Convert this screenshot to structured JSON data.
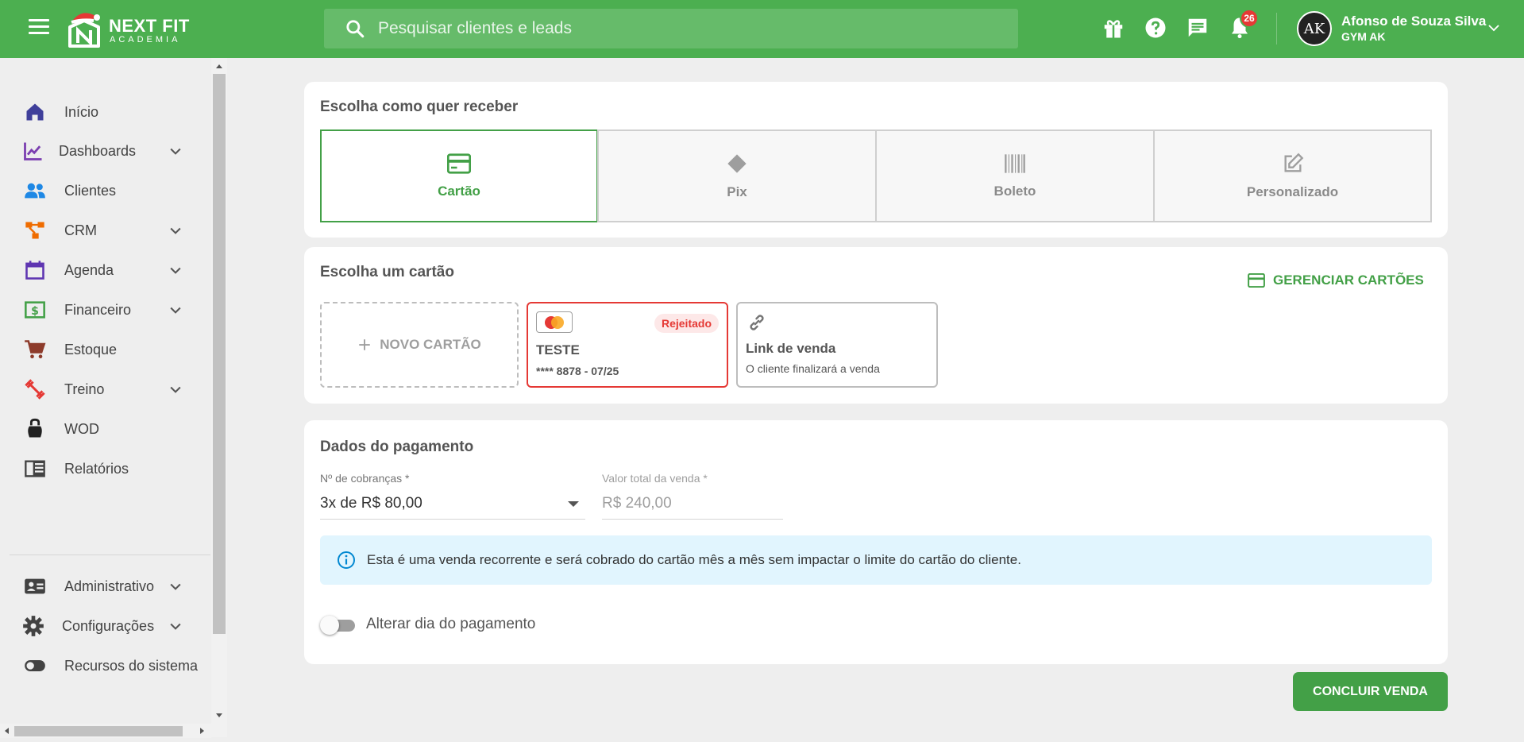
{
  "header": {
    "brand": "NEXT FIT",
    "brand_sub": "ACADEMIA",
    "search_placeholder": "Pesquisar clientes e leads",
    "notifications_count": "26",
    "user_name": "Afonso de Souza Silva",
    "user_org": "GYM AK",
    "avatar_initials": "AK"
  },
  "sidebar": {
    "items": [
      {
        "label": "Início",
        "icon": "home-icon",
        "color": "#3f3f9a"
      },
      {
        "label": "Dashboards",
        "icon": "chart-line-icon",
        "color": "#7b3fb0"
      },
      {
        "label": "Clientes",
        "icon": "people-icon",
        "color": "#1e88e5"
      },
      {
        "label": "CRM",
        "icon": "crm-icon",
        "color": "#ef6c00"
      },
      {
        "label": "Agenda",
        "icon": "calendar-icon",
        "color": "#5e35b1"
      },
      {
        "label": "Financeiro",
        "icon": "money-icon",
        "color": "#43a047"
      },
      {
        "label": "Estoque",
        "icon": "cart-icon",
        "color": "#8d3b2b"
      },
      {
        "label": "Treino",
        "icon": "dumbbell-icon",
        "color": "#e53935"
      },
      {
        "label": "WOD",
        "icon": "kettlebell-icon",
        "color": "#212121"
      },
      {
        "label": "Relatórios",
        "icon": "report-icon",
        "color": "#424242"
      },
      {
        "label": "Administrativo",
        "icon": "id-card-icon",
        "color": "#424242"
      },
      {
        "label": "Configurações",
        "icon": "gear-icon",
        "color": "#424242"
      },
      {
        "label": "Recursos do sistema",
        "icon": "toggle-icon",
        "color": "#424242"
      }
    ]
  },
  "receive": {
    "title": "Escolha como quer receber",
    "methods": [
      {
        "label": "Cartão",
        "icon": "credit-card-icon",
        "active": true
      },
      {
        "label": "Pix",
        "icon": "pix-icon",
        "active": false
      },
      {
        "label": "Boleto",
        "icon": "barcode-icon",
        "active": false
      },
      {
        "label": "Personalizado",
        "icon": "edit-icon",
        "active": false
      }
    ]
  },
  "cards": {
    "title": "Escolha um cartão",
    "manage_label": "GERENCIAR CARTÕES",
    "new_card_label": "NOVO CARTÃO",
    "saved": {
      "status": "Rejeitado",
      "name": "TESTE",
      "number": "**** 8878 - 07/25",
      "brand_icon": "mastercard-icon"
    },
    "link": {
      "title": "Link de venda",
      "subtitle": "O cliente finalizará a venda"
    }
  },
  "payment": {
    "title": "Dados do pagamento",
    "installments_label": "Nº de cobranças *",
    "installments_value": "3x de R$ 80,00",
    "total_label": "Valor total da venda *",
    "total_value": "R$ 240,00",
    "info_text": "Esta é uma venda recorrente e será cobrado do cartão mês a mês sem impactar o limite do cartão do cliente.",
    "toggle_label": "Alterar dia do pagamento",
    "toggle_on": false
  },
  "actions": {
    "submit_label": "CONCLUIR VENDA"
  },
  "colors": {
    "primary": "#4caf50",
    "accent": "#43a047",
    "danger": "#e53935",
    "info_bg": "#e1f5fe"
  }
}
